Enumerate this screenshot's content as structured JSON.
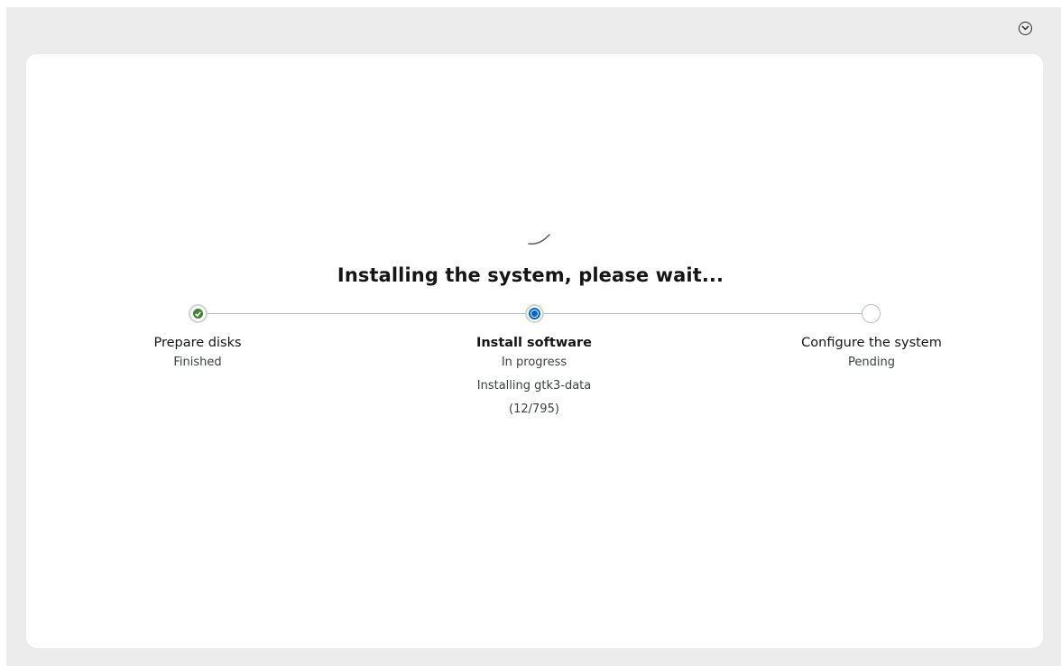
{
  "header": {
    "menu_icon": "chevron-down-circle-icon"
  },
  "main": {
    "spinner_icon": "spinner-icon",
    "title": "Installing the system, please wait...",
    "steps": [
      {
        "name": "Prepare disks",
        "status": "Finished",
        "state": "done",
        "icon": "check-circle-icon"
      },
      {
        "name": "Install software",
        "status": "In progress",
        "detail": "Installing gtk3-data",
        "progress": "(12/795)",
        "state": "active",
        "icon": "in-progress-icon"
      },
      {
        "name": "Configure the system",
        "status": "Pending",
        "state": "pending",
        "icon": "pending-circle-icon"
      }
    ]
  },
  "colors": {
    "background": "#ececec",
    "card": "#ffffff",
    "success": "#3e8635",
    "active": "#0066cc",
    "track": "#b8bbbe"
  }
}
